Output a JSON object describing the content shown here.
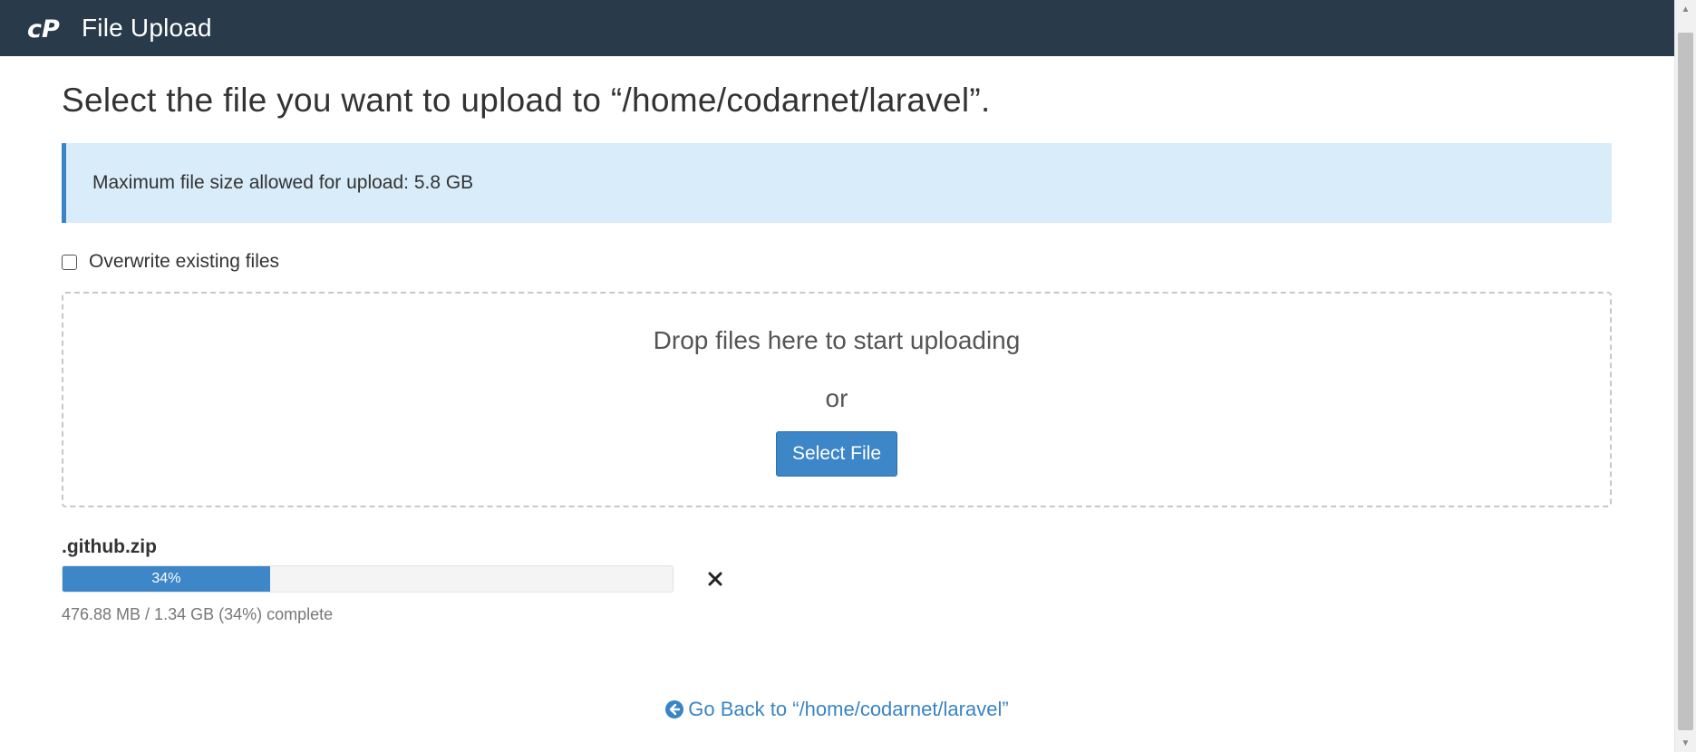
{
  "header": {
    "title": "File Upload",
    "logo_icon": "cpanel-logo",
    "background_color": "#293a4a"
  },
  "main": {
    "heading": "Select the file you want to upload to “/home/codarnet/laravel”.",
    "alert_text": "Maximum file size allowed for upload: 5.8 GB",
    "overwrite_label": "Overwrite existing files",
    "overwrite_checked": false,
    "dropzone": {
      "drop_text": "Drop files here to start uploading",
      "or_text": "or",
      "select_button_label": "Select File"
    },
    "upload": {
      "file_name": ".github.zip",
      "progress_percent": 34,
      "progress_label": "34%",
      "status_text": "476.88 MB / 1.34 GB (34%) complete",
      "cancel_icon": "close-icon"
    },
    "back_link_label": "Go Back to “/home/codarnet/laravel”",
    "back_icon": "arrow-circle-left-icon"
  },
  "colors": {
    "accent": "#3d86c8",
    "alert_bg": "#d8ecf9",
    "link": "#3a84c4"
  }
}
